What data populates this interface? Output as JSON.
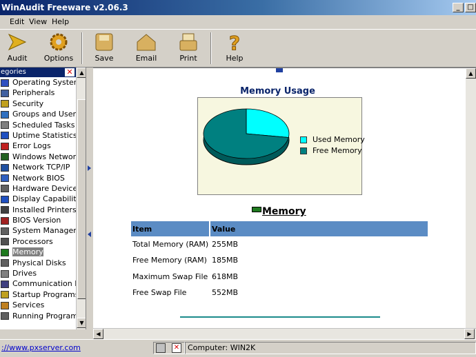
{
  "window": {
    "title": "WinAudit Freeware v2.06.3"
  },
  "menu": {
    "items": [
      "Edit",
      "View",
      "Help"
    ]
  },
  "toolbar": {
    "audit": "Audit",
    "options": "Options",
    "save": "Save",
    "email": "Email",
    "print": "Print",
    "help": "Help"
  },
  "sidebar": {
    "header": "egories",
    "items": [
      {
        "label": "Operating System",
        "color": "#3050c0"
      },
      {
        "label": "Peripherals",
        "color": "#4060a0"
      },
      {
        "label": "Security",
        "color": "#c0a020"
      },
      {
        "label": "Groups and Users",
        "color": "#3070c0"
      },
      {
        "label": "Scheduled Tasks",
        "color": "#808080"
      },
      {
        "label": "Uptime Statistics",
        "color": "#2050c0"
      },
      {
        "label": "Error Logs",
        "color": "#c02020"
      },
      {
        "label": "Windows Network",
        "color": "#206020"
      },
      {
        "label": "Network TCP/IP",
        "color": "#2050a0"
      },
      {
        "label": "Network BIOS",
        "color": "#3060c0"
      },
      {
        "label": "Hardware Devices",
        "color": "#606060"
      },
      {
        "label": "Display Capabilities",
        "color": "#2050c0"
      },
      {
        "label": "Installed Printers",
        "color": "#404040"
      },
      {
        "label": "BIOS Version",
        "color": "#a02020"
      },
      {
        "label": "System Management",
        "color": "#606060"
      },
      {
        "label": "Processors",
        "color": "#505050"
      },
      {
        "label": "Memory",
        "color": "#1f7a1f"
      },
      {
        "label": "Physical Disks",
        "color": "#606060"
      },
      {
        "label": "Drives",
        "color": "#808080"
      },
      {
        "label": "Communication Ports",
        "color": "#404080"
      },
      {
        "label": "Startup Programs",
        "color": "#c0a020"
      },
      {
        "label": "Services",
        "color": "#c08020"
      },
      {
        "label": "Running Programs",
        "color": "#606060"
      }
    ],
    "selected_index": 16
  },
  "content": {
    "chart_title": "Memory Usage",
    "section_title": "Memory",
    "columns": [
      "Item",
      "Value"
    ],
    "rows": [
      [
        "Total Memory (RAM)",
        "255MB"
      ],
      [
        "Free Memory (RAM)",
        "185MB"
      ],
      [
        "Maximum Swap File",
        "618MB"
      ],
      [
        "Free Swap File",
        "552MB"
      ]
    ]
  },
  "chart_data": {
    "type": "pie",
    "title": "Memory Usage",
    "labels": [
      "Used Memory",
      "Free Memory"
    ],
    "values": [
      70,
      185
    ],
    "colors": [
      "#00ffff",
      "#008080"
    ],
    "legend": "right"
  },
  "status": {
    "link": "://www.pxserver.com",
    "computer": "Computer: WIN2K"
  }
}
